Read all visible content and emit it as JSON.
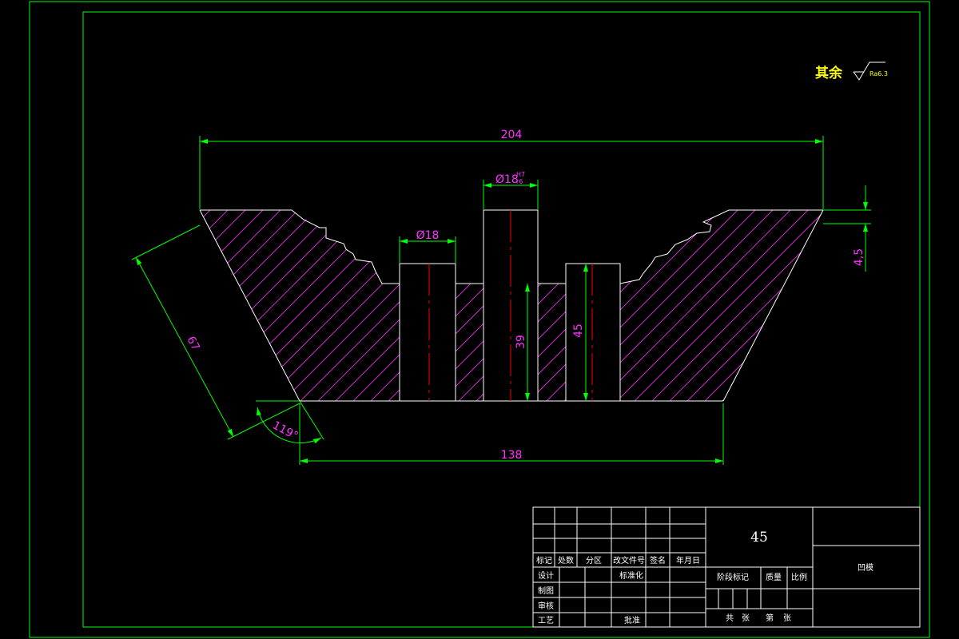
{
  "roughness_note": {
    "text": "其余",
    "symbol_value": "Ra6.3"
  },
  "dimensions": {
    "top_width": "204",
    "center_bore": "Ø18",
    "center_bore_tol_upper": "H7",
    "center_bore_tol_lower": "r6",
    "side_bore": "Ø18",
    "top_step": "4,5",
    "side_length": "67",
    "angle": "119°",
    "bottom_width": "138",
    "pin_height_left": "39",
    "pin_height_right": "45"
  },
  "title_block": {
    "material": "45",
    "part_name": "凹模",
    "rev_headers": [
      "标记",
      "处数",
      "分区",
      "改文件号",
      "签名",
      "年月日"
    ],
    "labels": {
      "design": "设计",
      "standardize": "标准化",
      "draw": "制图",
      "review": "审核",
      "process": "工艺",
      "approve": "批准",
      "stage_mark": "阶段标记",
      "mass": "质量",
      "scale": "比例",
      "total": "共",
      "sheet": "张",
      "page": "第",
      "sheet2": "张"
    }
  },
  "colors": {
    "border": "#00ff00",
    "outline": "#ffffff",
    "hatch": "#cc33cc",
    "dimension": "#00ff00",
    "dim_text": "#ff33ff",
    "center": "#ff0000",
    "note": "#ffff00"
  }
}
